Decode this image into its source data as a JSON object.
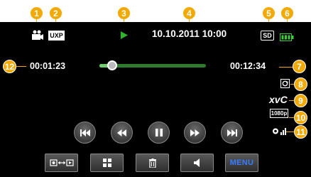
{
  "callouts": [
    "1",
    "2",
    "3",
    "4",
    "5",
    "6",
    "7",
    "8",
    "9",
    "10",
    "11",
    "12"
  ],
  "status": {
    "mode_badge": "UXP",
    "datetime": "10.10.2011 10:00",
    "media": "SD",
    "elapsed": "00:01:23",
    "total": "00:12:34",
    "format": "xvC",
    "resolution": "1080p",
    "playback_progress": 0.12
  },
  "bottom_bar": {
    "menu_label": "MENU"
  },
  "colors": {
    "accent": "#f2a900",
    "play": "#2db52d",
    "battery": "#3ccc3c",
    "menu_text": "#3a7bff"
  },
  "icons": [
    "video-camera-icon",
    "play-icon",
    "sd-card-icon",
    "battery-icon",
    "rotate-icon",
    "signal-icon",
    "rewind-icon",
    "skip-back-icon",
    "pause-icon",
    "skip-forward-icon",
    "fast-forward-icon",
    "mode-switch-icon",
    "grid-icon",
    "trash-icon",
    "volume-icon"
  ]
}
